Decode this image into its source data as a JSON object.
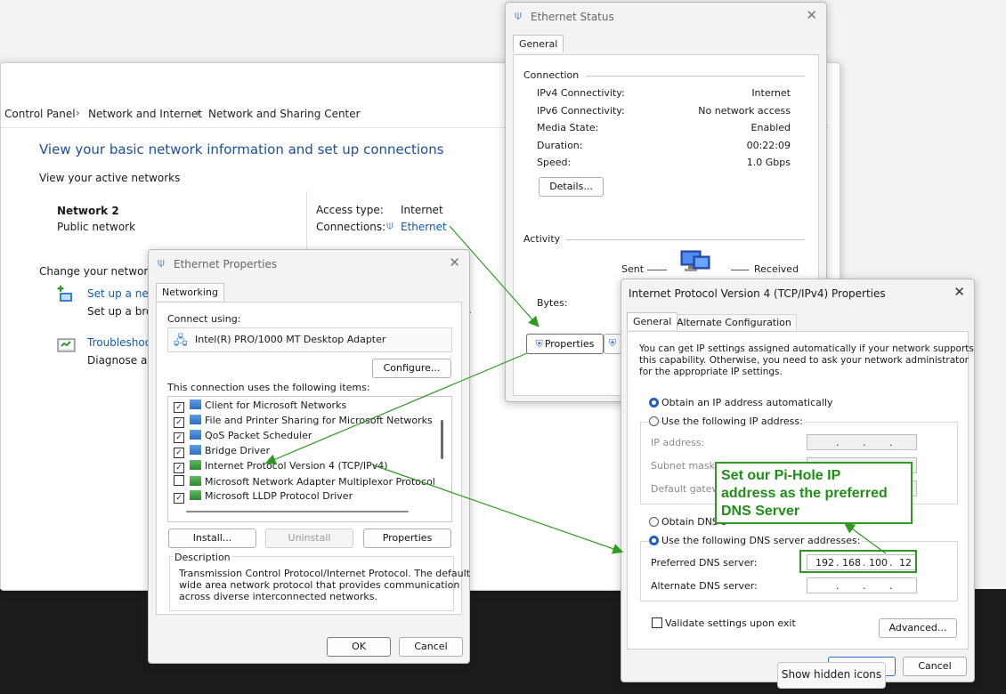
{
  "control_panel": {
    "breadcrumb": [
      "Control Panel",
      "Network and Internet",
      "Network and Sharing Center"
    ],
    "heading": "View your basic network information and set up connections",
    "active_networks_label": "View your active networks",
    "network_name": "Network 2",
    "network_type": "Public network",
    "access_type_label": "Access type:",
    "access_type_value": "Internet",
    "connections_label": "Connections:",
    "connections_value": "Ethernet",
    "change_settings_label": "Change your networkin",
    "setup_link": "Set up a new",
    "setup_desc": "Set up a broa",
    "troubleshoot_link": "Troubleshoot",
    "troubleshoot_desc": "Diagnose and",
    "dot": "."
  },
  "ethernet_status": {
    "title": "Ethernet Status",
    "tab": "General",
    "connection_group": "Connection",
    "rows": [
      {
        "label": "IPv4 Connectivity:",
        "value": "Internet"
      },
      {
        "label": "IPv6 Connectivity:",
        "value": "No network access"
      },
      {
        "label": "Media State:",
        "value": "Enabled"
      },
      {
        "label": "Duration:",
        "value": "00:22:09"
      },
      {
        "label": "Speed:",
        "value": "1.0 Gbps"
      }
    ],
    "details_button": "Details...",
    "activity_group": "Activity",
    "sent_label": "Sent",
    "received_label": "Received",
    "bytes_label": "Bytes:",
    "properties_button": "Properties"
  },
  "ethernet_properties": {
    "title": "Ethernet Properties",
    "tab": "Networking",
    "connect_using_label": "Connect using:",
    "adapter": "Intel(R) PRO/1000 MT Desktop Adapter",
    "configure_button": "Configure...",
    "items_label": "This connection uses the following items:",
    "items": [
      {
        "label": "Client for Microsoft Networks",
        "checked": true
      },
      {
        "label": "File and Printer Sharing for Microsoft Networks",
        "checked": true
      },
      {
        "label": "QoS Packet Scheduler",
        "checked": true
      },
      {
        "label": "Bridge Driver",
        "checked": true
      },
      {
        "label": "Internet Protocol Version 4 (TCP/IPv4)",
        "checked": true
      },
      {
        "label": "Microsoft Network Adapter Multiplexor Protocol",
        "checked": false
      },
      {
        "label": "Microsoft LLDP Protocol Driver",
        "checked": true
      }
    ],
    "install_button": "Install...",
    "uninstall_button": "Uninstall",
    "properties_button": "Properties",
    "description_label": "Description",
    "description_text": [
      "Transmission Control Protocol/Internet Protocol. The default",
      "wide area network protocol that provides communication",
      "across diverse interconnected networks."
    ],
    "ok_button": "OK",
    "cancel_button": "Cancel"
  },
  "ipv4_properties": {
    "title": "Internet Protocol Version 4 (TCP/IPv4) Properties",
    "tab_general": "General",
    "tab_alternate": "Alternate Configuration",
    "intro": [
      "You can get IP settings assigned automatically if your network supports",
      "this capability. Otherwise, you need to ask your network administrator",
      "for the appropriate IP settings."
    ],
    "obtain_ip_auto": "Obtain an IP address automatically",
    "use_following_ip": "Use the following IP address:",
    "ip_address_label": "IP address:",
    "subnet_mask_label": "Subnet mask:",
    "default_gateway_label": "Default gatewa",
    "obtain_dns_auto": "Obtain DNS s",
    "use_following_dns": "Use the following DNS server addresses:",
    "preferred_dns_label": "Preferred DNS server:",
    "preferred_dns_octets": [
      "192",
      "168",
      "100",
      "12"
    ],
    "alternate_dns_label": "Alternate DNS server:",
    "octet_dot": ".",
    "validate_label": "Validate settings upon exit",
    "advanced_button": "Advanced...",
    "cancel_button": "Cancel"
  },
  "callout": {
    "lines": [
      "Set our Pi-Hole IP",
      "address as the preferred",
      "DNS Server"
    ],
    "color": "#2e9b20"
  },
  "tooltip": "Show hidden icons"
}
